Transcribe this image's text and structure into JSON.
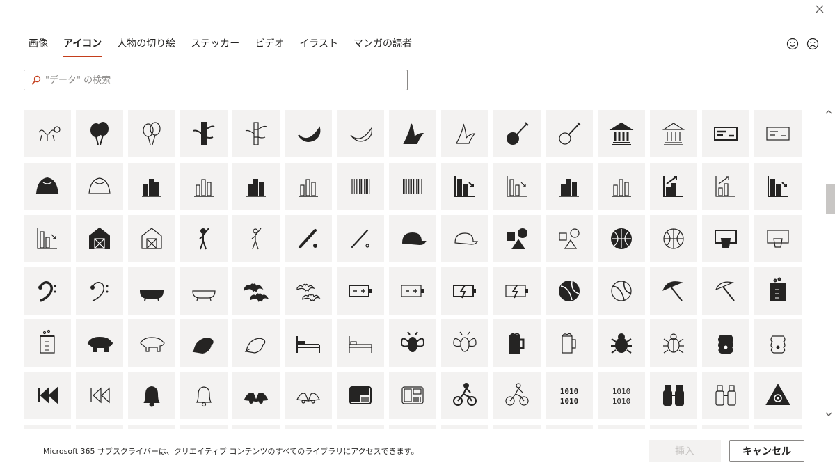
{
  "tabs": [
    {
      "label": "画像",
      "active": false
    },
    {
      "label": "アイコン",
      "active": true
    },
    {
      "label": "人物の切り絵",
      "active": false
    },
    {
      "label": "ステッカー",
      "active": false
    },
    {
      "label": "ビデオ",
      "active": false
    },
    {
      "label": "イラスト",
      "active": false
    },
    {
      "label": "マンガの読者",
      "active": false
    }
  ],
  "search": {
    "placeholder": "\"データ\" の検索"
  },
  "footer": {
    "note": "Microsoft 365 サブスクライバーは、クリエイティブ コンテンツのすべてのライブラリにアクセスできます。",
    "insert_label": "挿入",
    "cancel_label": "キャンセル"
  },
  "colors": {
    "accent": "#c43e1c",
    "tile_bg": "#f3f2f1",
    "icon": "#252423"
  },
  "icon_rows": [
    [
      "balloon-dog-icon",
      "balloons-filled-icon",
      "balloons-outline-icon",
      "bamboo-filled-icon",
      "bamboo-outline-icon",
      "banana-filled-icon",
      "banana-outline-icon",
      "banana-peel-filled-icon",
      "banana-peel-outline-icon",
      "banjo-filled-icon",
      "banjo-outline-icon",
      "bank-filled-icon",
      "bank-outline-icon",
      "bank-check-filled-icon",
      "bank-check-outline-icon"
    ],
    [
      "bao-bun-filled-icon",
      "bao-bun-outline-icon",
      "bar-chart-filled-icon",
      "bar-chart-outline-icon",
      "bar-chart-upward-filled-icon",
      "bar-chart-upward-outline-icon",
      "barcode-filled-icon",
      "barcode-outline-icon",
      "bar-chart-downward-filled-icon",
      "bar-chart-downward-outline-icon",
      "bar-graph-upward-filled-icon",
      "bar-graph-upward-outline-icon",
      "bar-graph-arrow-up-filled-icon",
      "bar-graph-arrow-up-outline-icon",
      "bar-graph-arrow-down-filled-icon"
    ],
    [
      "bar-graph-arrow-down-outline-icon",
      "barn-filled-icon",
      "barn-outline-icon",
      "baseball-player-filled-icon",
      "baseball-player-outline-icon",
      "baseball-bat-filled-icon",
      "baseball-bat-outline-icon",
      "baseball-cap-filled-icon",
      "baseball-cap-outline-icon",
      "basic-shapes-filled-icon",
      "basic-shapes-outline-icon",
      "basketball-filled-icon",
      "basketball-outline-icon",
      "basketball-hoop-filled-icon",
      "basketball-hoop-outline-icon"
    ],
    [
      "bass-clef-filled-icon",
      "bass-clef-outline-icon",
      "bathtub-filled-icon",
      "bathtub-outline-icon",
      "bats-filled-icon",
      "bats-outline-icon",
      "battery-filled-icon",
      "battery-outline-icon",
      "battery-charging-filled-icon",
      "battery-charging-outline-icon",
      "beach-ball-filled-icon",
      "beach-ball-outline-icon",
      "beach-umbrella-filled-icon",
      "beach-umbrella-outline-icon",
      "beaker-filled-icon"
    ],
    [
      "beaker-outline-icon",
      "bear-filled-icon",
      "bear-outline-icon",
      "beaver-filled-icon",
      "beaver-outline-icon",
      "bed-filled-icon",
      "bed-outline-icon",
      "bee-filled-icon",
      "bee-outline-icon",
      "beer-mug-filled-icon",
      "beer-mug-outline-icon",
      "beetle-filled-icon",
      "beetle-outline-icon",
      "beehive-filled-icon",
      "beehive-outline-icon"
    ],
    [
      "skip-back-filled-icon",
      "skip-back-outline-icon",
      "bell-filled-icon",
      "bell-outline-icon",
      "bells-filled-icon",
      "bells-outline-icon",
      "bento-box-filled-icon",
      "bento-box-outline-icon",
      "cyclist-filled-icon",
      "cyclist-outline-icon",
      "binary-filled-icon",
      "binary-outline-icon",
      "binoculars-filled-icon",
      "binoculars-outline-icon",
      "biohazard-filled-icon"
    ]
  ]
}
